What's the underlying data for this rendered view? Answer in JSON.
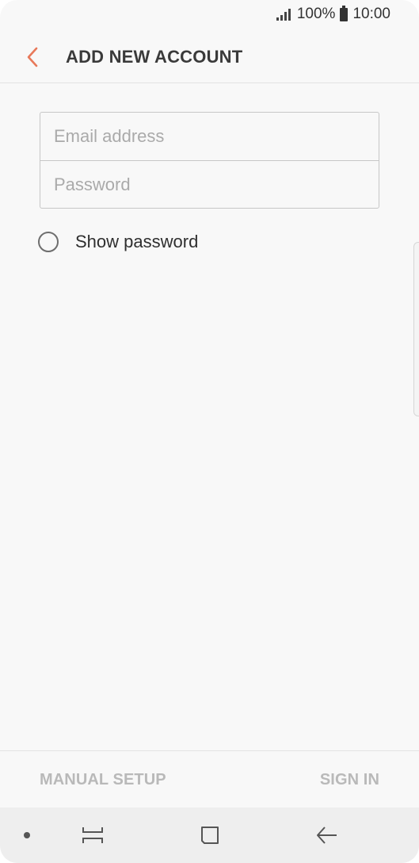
{
  "status_bar": {
    "battery_percent": "100%",
    "time": "10:00",
    "signal_icon": "signal-icon",
    "battery_icon": "battery-icon"
  },
  "header": {
    "title": "ADD NEW ACCOUNT",
    "back_icon": "chevron-left-icon",
    "accent_color": "#e8795a"
  },
  "form": {
    "email_placeholder": "Email address",
    "email_value": "",
    "password_placeholder": "Password",
    "password_value": "",
    "show_password_label": "Show password",
    "show_password_checked": false
  },
  "actions": {
    "manual_setup_label": "MANUAL SETUP",
    "sign_in_label": "SIGN IN"
  },
  "nav_bar": {
    "recents_icon": "recents-icon",
    "home_icon": "home-icon",
    "back_icon": "back-arrow-icon"
  }
}
